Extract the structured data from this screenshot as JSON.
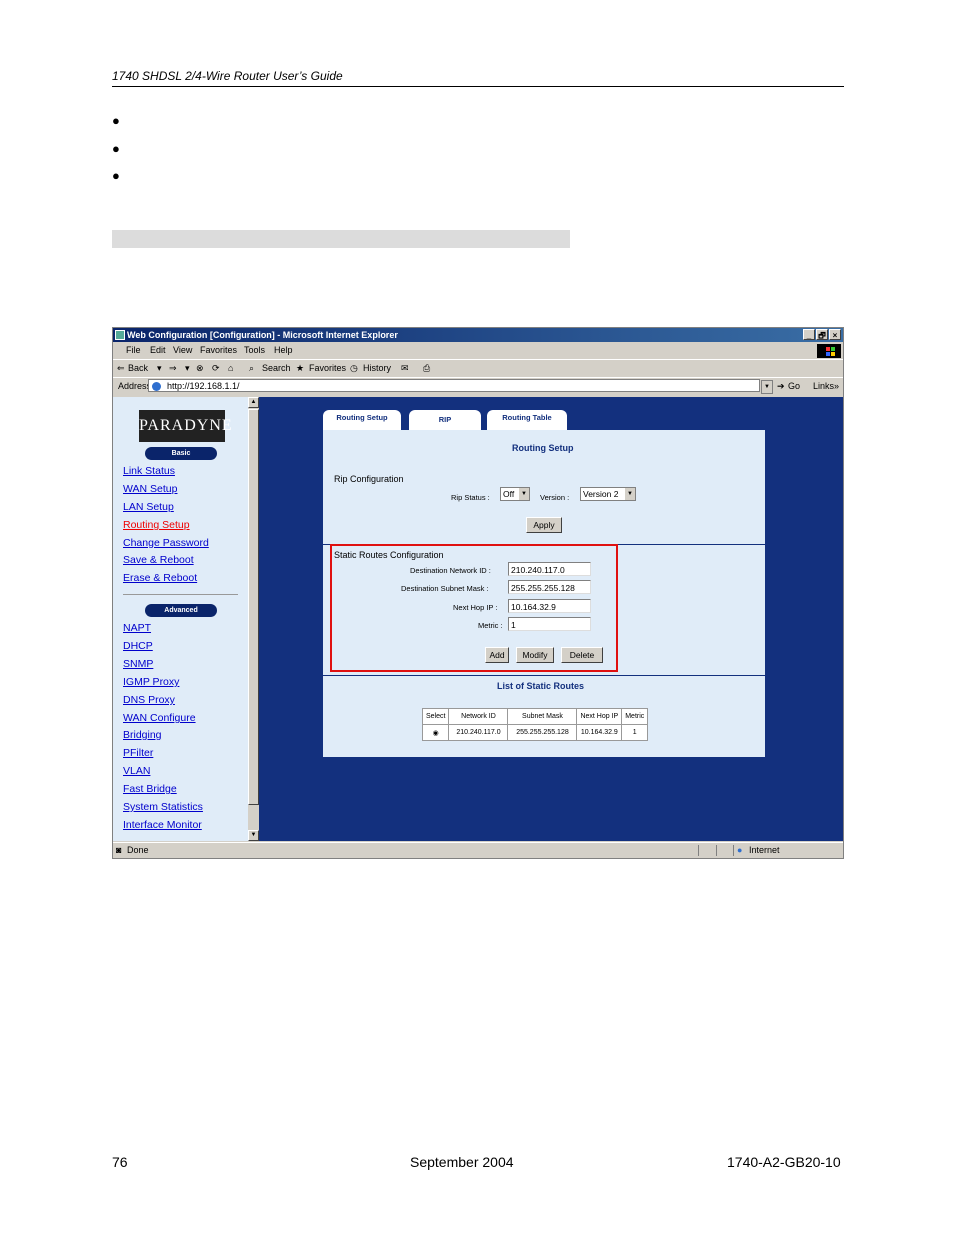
{
  "doc": {
    "header_title": "1740 SHDSL 2/4-Wire Router User’s Guide",
    "bullets": [
      "●",
      "●",
      "●"
    ],
    "footer_page": "76",
    "footer_date": "September 2004",
    "footer_docnum": "1740-A2-GB20-10"
  },
  "browser": {
    "title": "Web Configuration [Configuration] - Microsoft Internet Explorer",
    "window_buttons": [
      "_",
      "🗗",
      "×"
    ],
    "menu": [
      "File",
      "Edit",
      "View",
      "Favorites",
      "Tools",
      "Help"
    ],
    "toolbar": {
      "back": "Back",
      "forward": "⇒",
      "search": "Search",
      "favorites": "Favorites",
      "history": "History"
    },
    "address_label": "Address",
    "address_value": "http://192.168.1.1/",
    "go_label": "Go",
    "links_label": "Links",
    "status_text": "Done",
    "zone_text": "Internet"
  },
  "sidebar": {
    "logo_text": "PARADYNE",
    "basic_label": "Basic",
    "basic_items": [
      "Link Status",
      "WAN Setup",
      "LAN Setup",
      "Routing Setup",
      "Change Password",
      "Save & Reboot",
      "Erase & Reboot"
    ],
    "advanced_label": "Advanced",
    "advanced_items": [
      "NAPT",
      "DHCP",
      "SNMP",
      "IGMP Proxy",
      "DNS Proxy",
      "WAN Configure",
      "Bridging",
      "PFilter",
      "VLAN",
      "Fast Bridge",
      "System Statistics",
      "Interface Monitor"
    ]
  },
  "tabs": [
    "Routing Setup",
    "RIP",
    "Routing Table"
  ],
  "routing": {
    "title": "Routing Setup",
    "rip_section": "Rip Configuration",
    "rip_status_label": "Rip Status :",
    "rip_status_value": "Off",
    "version_label": "Version :",
    "version_value": "Version 2",
    "apply_label": "Apply",
    "static_section": "Static Routes Configuration",
    "dest_net_label": "Destination Network ID :",
    "dest_net_value": "210.240.117.0",
    "dest_mask_label": "Destination Subnet Mask :",
    "dest_mask_value": "255.255.255.128",
    "next_hop_label": "Next Hop IP :",
    "next_hop_value": "10.164.32.9",
    "metric_label": "Metric :",
    "metric_value": "1",
    "add_label": "Add",
    "modify_label": "Modify",
    "delete_label": "Delete",
    "list_title": "List of Static Routes",
    "table_headers": [
      "Select",
      "Network ID",
      "Subnet Mask",
      "Next Hop IP",
      "Metric"
    ],
    "table_rows": [
      {
        "select": "◉",
        "network_id": "210.240.117.0",
        "subnet_mask": "255.255.255.128",
        "next_hop": "10.164.32.9",
        "metric": "1"
      }
    ]
  },
  "colors": {
    "accent": "#13307e",
    "highlight_box": "#e01010",
    "active_link": "#e00000",
    "link": "#0000cc"
  }
}
